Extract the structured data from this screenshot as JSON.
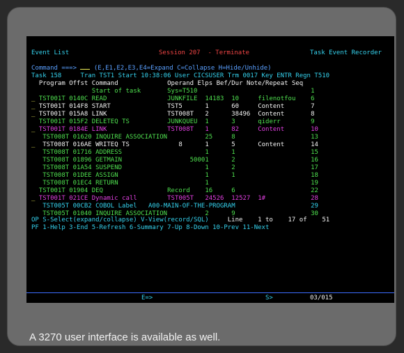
{
  "header": {
    "left": "Event List",
    "center": "Session 207  - Terminate",
    "right": "Task Event Recorder"
  },
  "command": {
    "label": "Command ===>",
    "options": "(E,E1,E2,E3,E4=Expand C=Collapse H=Hide/Unhide)"
  },
  "task": {
    "label": "Task 158",
    "info": "Tran TST1 Start 10:38:06 User CICSUSER Trm 0017 Key ENTR Regn T510"
  },
  "columns": {
    "program": "Program",
    "offst": "Offst",
    "command": "Command",
    "operand": "Operand",
    "elps": "Elps",
    "befdur": "Bef/Dur",
    "note": "Note/Repeat",
    "seq": "Seq"
  },
  "rows": [
    {
      "sel": "",
      "prog": "",
      "off": "",
      "cmd": "Start of task",
      "op": "Sys=T510",
      "elps": "",
      "bef": "",
      "note": "",
      "seq": "1"
    },
    {
      "sel": "_",
      "prog": "TST001T",
      "off": "0140C",
      "cmd": "READ",
      "op": "JUNKFILE",
      "elps": "14183",
      "bef": "10",
      "note": "filenotfou",
      "seq": "6"
    },
    {
      "sel": "_",
      "prog": "TST001T",
      "off": "014F8",
      "cmd": "START",
      "op": "TST5",
      "elps": "1",
      "bef": "60",
      "note": "Content",
      "seq": "7"
    },
    {
      "sel": "_",
      "prog": "TST001T",
      "off": "015A8",
      "cmd": "LINK",
      "op": "TST008T",
      "elps": "2",
      "bef": "38496",
      "note": "Content",
      "seq": "8"
    },
    {
      "sel": "",
      "prog": "TST001T",
      "off": "015F2",
      "cmd": "DELETEQ TS",
      "op": "JUNKQUEU",
      "elps": "1",
      "bef": "3",
      "note": "qiderr",
      "seq": "9"
    },
    {
      "sel": "_",
      "prog": "TST001T",
      "off": "0184E",
      "cmd": "LINK",
      "op": "TST008T",
      "elps": "1",
      "bef": "82",
      "note": "Content",
      "seq": "10"
    },
    {
      "sel": "",
      "prog": "TST008T",
      "off": "01620",
      "cmd": "INQUIRE ASSOCIATION",
      "op": "",
      "elps": "25",
      "bef": "8",
      "note": "",
      "seq": "13"
    },
    {
      "sel": "_",
      "prog": "TST008T",
      "off": "016AE",
      "cmd": "WRITEQ TS",
      "op": "8",
      "elps": "1",
      "bef": "5",
      "note": "Content",
      "seq": "14"
    },
    {
      "sel": "",
      "prog": "TST008T",
      "off": "01716",
      "cmd": "ADDRESS",
      "op": "",
      "elps": "1",
      "bef": "1",
      "note": "",
      "seq": "15"
    },
    {
      "sel": "",
      "prog": "TST008T",
      "off": "01896",
      "cmd": "GETMAIN",
      "op": "5000",
      "elps": "1",
      "bef": "2",
      "note": "",
      "seq": "16"
    },
    {
      "sel": "",
      "prog": "TST008T",
      "off": "01A54",
      "cmd": "SUSPEND",
      "op": "",
      "elps": "1",
      "bef": "2",
      "note": "",
      "seq": "17"
    },
    {
      "sel": "",
      "prog": "TST008T",
      "off": "01DEE",
      "cmd": "ASSIGN",
      "op": "",
      "elps": "1",
      "bef": "1",
      "note": "",
      "seq": "18"
    },
    {
      "sel": "",
      "prog": "TST008T",
      "off": "01EC4",
      "cmd": "RETURN",
      "op": "",
      "elps": "1",
      "bef": "",
      "note": "",
      "seq": "19"
    },
    {
      "sel": "",
      "prog": "TST001T",
      "off": "01904",
      "cmd": "DEQ",
      "op": "Record",
      "elps": "16",
      "bef": "6",
      "note": "",
      "seq": "22"
    },
    {
      "sel": "_",
      "prog": "TST001T",
      "off": "021CE",
      "cmd": "Dynamic call",
      "op": "TST005T",
      "elps": "24526",
      "bef": "12527",
      "note": "1#",
      "seq": "28"
    },
    {
      "sel": "",
      "prog": "TST005T",
      "off": "00CB2",
      "cmd": "COBOL Label",
      "op": "A00-MAIN-OF-THE-PROGRAM",
      "elps": "",
      "bef": "",
      "note": "",
      "seq": "29"
    },
    {
      "sel": "",
      "prog": "TST005T",
      "off": "01040",
      "cmd": "INQUIRE ASSOCIATION",
      "op": "",
      "elps": "2",
      "bef": "9",
      "note": "",
      "seq": "30"
    }
  ],
  "status": {
    "op": "OP S-Select(expand/collapse) V-View(record/SQL)",
    "line_label": "Line",
    "line_from": "1",
    "to_label": "to",
    "line_to": "17",
    "of_label": "of",
    "total": "51"
  },
  "pf_keys": "PF 1-Help 3-End 5-Refresh 6-Summary 7-Up 8-Down 10-Prev 11-Next",
  "bottom": {
    "e": "E=>",
    "s": "S>",
    "page": "03/015"
  },
  "caption": "A 3270 user interface is available as well."
}
